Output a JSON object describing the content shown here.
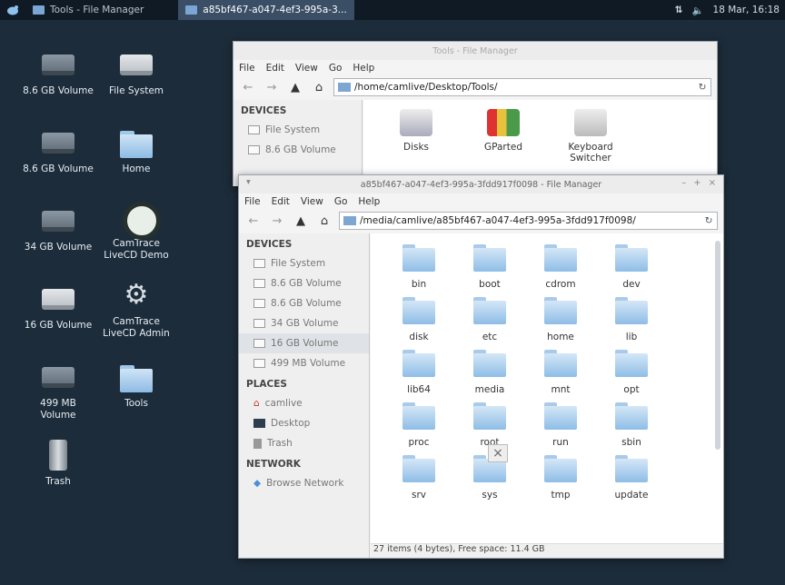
{
  "panel": {
    "tasks": [
      {
        "label": "Tools - File Manager"
      },
      {
        "label": "a85bf467-a047-4ef3-995a-3..."
      }
    ],
    "clock": "18 Mar, 16:18",
    "network_glyph": "⇅",
    "volume_glyph": "🔈"
  },
  "desktop": {
    "icons": [
      {
        "label": "8.6 GB Volume",
        "icon": "drive-icon"
      },
      {
        "label": "File System",
        "icon": "drive-icon"
      },
      {
        "label": "8.6 GB Volume",
        "icon": "drive-icon"
      },
      {
        "label": "Home",
        "icon": "home-folder-icon"
      },
      {
        "label": "34 GB Volume",
        "icon": "drive-icon"
      },
      {
        "label": "CamTrace LiveCD Demo",
        "icon": "camtrace-icon"
      },
      {
        "label": "16 GB Volume",
        "icon": "drive-icon"
      },
      {
        "label": "CamTrace LiveCD Admin",
        "icon": "gears-icon"
      },
      {
        "label": "499 MB Volume",
        "icon": "drive-icon"
      },
      {
        "label": "Tools",
        "icon": "folder-icon"
      },
      {
        "label": "Trash",
        "icon": "trash-icon"
      }
    ]
  },
  "back_window": {
    "title": "Tools - File Manager",
    "menu": [
      "File",
      "Edit",
      "View",
      "Go",
      "Help"
    ],
    "path": "/home/camlive/Desktop/Tools/",
    "devices_header": "DEVICES",
    "devices": [
      "File System",
      "8.6 GB Volume"
    ],
    "apps": [
      {
        "label": "Disks",
        "icon": "disks-icon"
      },
      {
        "label": "GParted",
        "icon": "gparted-icon"
      },
      {
        "label": "Keyboard Switcher",
        "icon": "keyboard-icon"
      }
    ]
  },
  "front_window": {
    "title": "a85bf467-a047-4ef3-995a-3fdd917f0098 - File Manager",
    "menu": [
      "File",
      "Edit",
      "View",
      "Go",
      "Help"
    ],
    "path": "/media/camlive/a85bf467-a047-4ef3-995a-3fdd917f0098/",
    "devices_header": "DEVICES",
    "devices": [
      "File System",
      "8.6 GB Volume",
      "8.6 GB Volume",
      "34 GB Volume",
      "16 GB Volume",
      "499 MB Volume"
    ],
    "selected_device_index": 4,
    "places_header": "PLACES",
    "places": [
      "camlive",
      "Desktop",
      "Trash"
    ],
    "network_header": "NETWORK",
    "network": [
      "Browse Network"
    ],
    "folders": [
      "bin",
      "boot",
      "cdrom",
      "dev",
      "disk",
      "etc",
      "home",
      "lib",
      "lib64",
      "media",
      "mnt",
      "opt",
      "proc",
      "root",
      "run",
      "sbin",
      "srv",
      "sys",
      "tmp",
      "update"
    ],
    "status": "27 items (4 bytes), Free space: 11.4 GB"
  },
  "colors": {
    "desktop": "#1d2c3a",
    "panel": "#0f1a24",
    "active_task": "#3a4e66",
    "folder": "#8ebde6"
  }
}
